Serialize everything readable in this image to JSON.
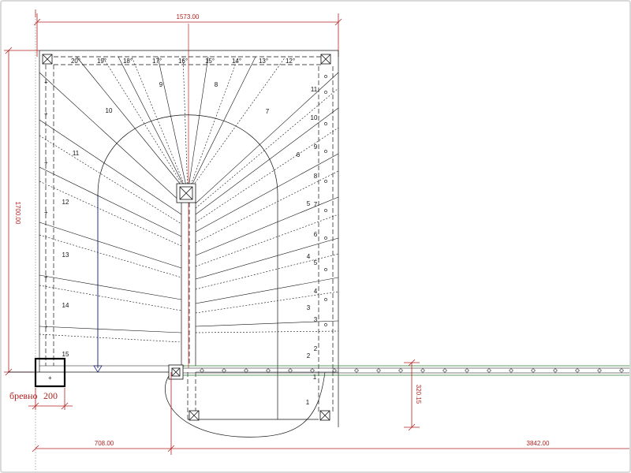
{
  "dimensions": {
    "top_width": "1573.00",
    "left_height": "1700.00",
    "landing_offset": "320.15",
    "bottom_left": "708.00",
    "bottom_right": "3842.00"
  },
  "labels": {
    "log_label": "бревно",
    "log_value": "200"
  },
  "step_numbers": {
    "left_flight": [
      "15",
      "14",
      "13",
      "12",
      "11",
      "10",
      "9",
      "8"
    ],
    "right_outer": [
      "1",
      "2",
      "3",
      "4",
      "5",
      "6",
      "7"
    ],
    "right_inner": [
      "1",
      "2",
      "3",
      "4",
      "5",
      "6",
      "7",
      "8",
      "9",
      "10",
      "11"
    ],
    "right_inner_extra": [
      "3",
      "4",
      "5"
    ]
  },
  "degree_marks": [
    "20°",
    "19°",
    "18°",
    "17°",
    "16°",
    "15°",
    "14°",
    "13°",
    "12°"
  ],
  "colors": {
    "drawing_line": "#111111",
    "dimension": "#b22222",
    "blue_axis": "#1a2a8a",
    "green_rail": "#2e7d32",
    "log_box": "#000000"
  },
  "icons": {
    "post": "post-square-x-icon",
    "arrow": "down-arrow-icon",
    "peg": "rail-peg-icon"
  }
}
